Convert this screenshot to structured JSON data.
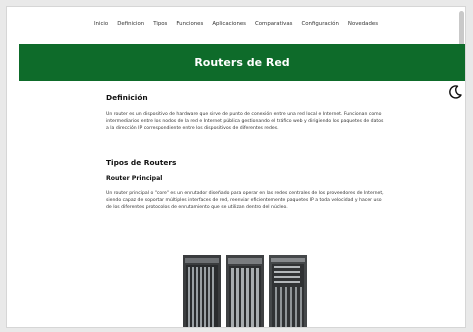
{
  "nav": {
    "items": [
      "Inicio",
      "Definicion",
      "Tipos",
      "Funciones",
      "Aplicaciones",
      "Comparativas",
      "Configuración",
      "Novedades"
    ]
  },
  "hero": {
    "title": "Routers de Red"
  },
  "colors": {
    "brand": "#0e6b2a",
    "background": "#ffffff"
  },
  "icons": {
    "theme_toggle": "moon-icon"
  },
  "definicion": {
    "heading": "Definición",
    "text": "Un router es un dispositivo de hardware que sirve de punto de conexión entre una red local e Internet. Funcionan como intermediarios entre los nodos de la red e Internet pública gestionando el tráfico web y dirigiendo los paquetes de datos a la dirección IP correspondiente entre los dispositivos de diferentes redes."
  },
  "tipos": {
    "heading": "Tipos de Routers",
    "router_principal": {
      "heading": "Router Principal",
      "text": "Un router principal o \"core\" es un enrutador diseñado para operar en las redes centrales de los proveedores de Internet, siendo capaz de soportar múltiples interfaces de red, reenviar eficientemente paquetes IP a toda velocidad y hacer uso de los diferentes protocolos de enrutamiento que se utilizan dentro del núcleo."
    }
  }
}
